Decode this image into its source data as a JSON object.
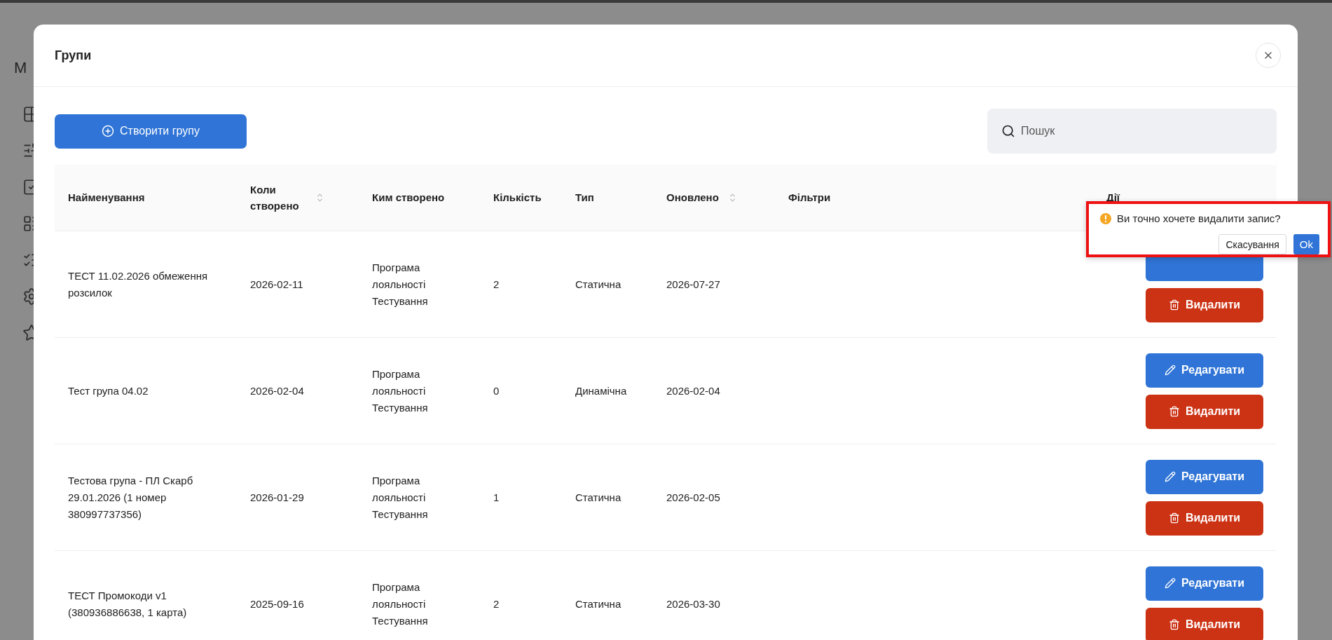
{
  "app": {
    "title_letter": "М"
  },
  "modal": {
    "title": "Групи",
    "create_button": "Створити групу",
    "search": {
      "placeholder": "Пошук"
    },
    "columns": [
      {
        "label": "Найменування",
        "sortable": false
      },
      {
        "label": "Коли створено",
        "sortable": true
      },
      {
        "label": "Ким створено",
        "sortable": false
      },
      {
        "label": "Кількість",
        "sortable": false
      },
      {
        "label": "Тип",
        "sortable": false
      },
      {
        "label": "Оновлено",
        "sortable": true
      },
      {
        "label": "Фільтри",
        "sortable": false
      },
      {
        "label": "Дії",
        "sortable": false
      }
    ],
    "rows": [
      {
        "name": "ТЕСТ 11.02.2026 обмеження розсилок",
        "created": "2026-02-11",
        "author": "Програма лояльності Тестування",
        "count": "2",
        "type": "Статична",
        "updated": "2026-07-27",
        "actions": [
          {
            "kind": "edit"
          },
          {
            "kind": "delete",
            "label": "Видалити"
          }
        ]
      },
      {
        "name": "Тест група 04.02",
        "created": "2026-02-04",
        "author": "Програма лояльності Тестування",
        "count": "0",
        "type": "Динамічна",
        "updated": "2026-02-04",
        "actions": [
          {
            "kind": "edit",
            "label": "Редагувати"
          },
          {
            "kind": "delete",
            "label": "Видалити"
          }
        ]
      },
      {
        "name": "Тестова група - ПЛ Скарб 29.01.2026 (1 номер 380997737356)",
        "created": "2026-01-29",
        "author": "Програма лояльності Тестування",
        "count": "1",
        "type": "Статична",
        "updated": "2026-02-05",
        "actions": [
          {
            "kind": "edit",
            "label": "Редагувати"
          },
          {
            "kind": "delete",
            "label": "Видалити"
          }
        ]
      },
      {
        "name": "ТЕСТ Промокоди v1 (380936886638, 1 карта)",
        "created": "2025-09-16",
        "author": "Програма лояльності Тестування",
        "count": "2",
        "type": "Статична",
        "updated": "2026-03-30",
        "actions": [
          {
            "kind": "edit",
            "label": "Редагувати"
          },
          {
            "kind": "delete",
            "label": "Видалити"
          }
        ]
      }
    ]
  },
  "confirm": {
    "message": "Ви точно хочете видалити запис?",
    "cancel": "Скасування",
    "ok": "Ok"
  }
}
